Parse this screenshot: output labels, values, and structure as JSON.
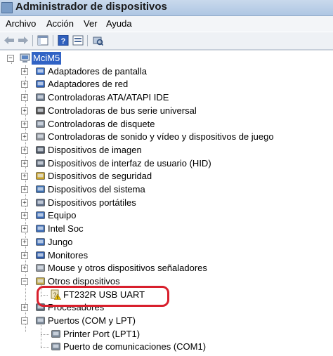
{
  "window": {
    "title": "Administrador de dispositivos"
  },
  "menu": [
    "Archivo",
    "Acción",
    "Ver",
    "Ayuda"
  ],
  "toolbar": [
    "back-arrow-icon",
    "forward-arrow-icon",
    "console-tree-icon",
    "help-icon",
    "properties-icon",
    "scan-hardware-icon"
  ],
  "tree": {
    "root": "MciM5",
    "categories": [
      {
        "label": "Adaptadores de pantalla",
        "icon": "display-adapter-icon",
        "expanded": false
      },
      {
        "label": "Adaptadores de red",
        "icon": "network-adapter-icon",
        "expanded": false
      },
      {
        "label": "Controladoras ATA/ATAPI IDE",
        "icon": "ide-controller-icon",
        "expanded": false
      },
      {
        "label": "Controladoras de bus serie universal",
        "icon": "usb-controller-icon",
        "expanded": false
      },
      {
        "label": "Controladoras de disquete",
        "icon": "floppy-controller-icon",
        "expanded": false
      },
      {
        "label": "Controladoras de sonido y vídeo y dispositivos de juego",
        "icon": "sound-controller-icon",
        "expanded": false
      },
      {
        "label": "Dispositivos de imagen",
        "icon": "imaging-device-icon",
        "expanded": false
      },
      {
        "label": "Dispositivos de interfaz de usuario (HID)",
        "icon": "hid-device-icon",
        "expanded": false
      },
      {
        "label": "Dispositivos de seguridad",
        "icon": "security-device-icon",
        "expanded": false
      },
      {
        "label": "Dispositivos del sistema",
        "icon": "system-device-icon",
        "expanded": false
      },
      {
        "label": "Dispositivos portátiles",
        "icon": "portable-device-icon",
        "expanded": false
      },
      {
        "label": "Equipo",
        "icon": "computer-icon",
        "expanded": false
      },
      {
        "label": "Intel Soc",
        "icon": "intel-soc-icon",
        "expanded": false
      },
      {
        "label": "Jungo",
        "icon": "jungo-icon",
        "expanded": false
      },
      {
        "label": "Monitores",
        "icon": "monitor-icon",
        "expanded": false
      },
      {
        "label": "Mouse y otros dispositivos señaladores",
        "icon": "mouse-icon",
        "expanded": false
      },
      {
        "label": "Otros dispositivos",
        "icon": "other-devices-icon",
        "expanded": true,
        "children": [
          {
            "label": "FT232R USB UART",
            "icon": "unknown-device-warning-icon"
          }
        ]
      },
      {
        "label": "Procesadores",
        "icon": "processor-icon",
        "expanded": false
      },
      {
        "label": "Puertos (COM y LPT)",
        "icon": "port-icon",
        "expanded": true,
        "children": [
          {
            "label": "Printer Port (LPT1)",
            "icon": "printer-port-icon"
          },
          {
            "label": "Puerto de comunicaciones (COM1)",
            "icon": "com-port-icon"
          }
        ]
      }
    ]
  },
  "colors": {
    "selection": "#3163c5",
    "annotation_circle": "#d81f2c",
    "warning": "#f2c200"
  }
}
